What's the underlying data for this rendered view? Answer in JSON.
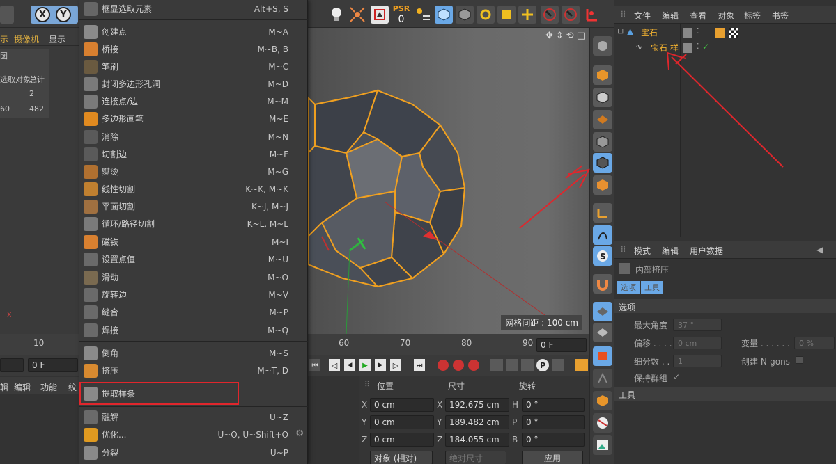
{
  "toolbar": {
    "axis_x": "X",
    "axis_y": "Y",
    "psr_label": "PSR",
    "psr_value": "0"
  },
  "left_panel": {
    "tabs": [
      "示",
      "摄像机",
      "显示"
    ],
    "tab3_label": "图",
    "stats_header": [
      "选取对象",
      "总计"
    ],
    "stats_row1": [
      "",
      "2"
    ],
    "stats_row2": [
      "60",
      "482"
    ]
  },
  "menu": {
    "items": [
      {
        "label": "框显选取元素",
        "shortcut": "Alt+S, S",
        "icon": "frame-select-icon"
      },
      {
        "label": "创建点",
        "shortcut": "M~A",
        "icon": "create-point-icon"
      },
      {
        "label": "桥接",
        "shortcut": "M~B, B",
        "icon": "bridge-icon"
      },
      {
        "label": "笔刷",
        "shortcut": "M~C",
        "icon": "brush-icon"
      },
      {
        "label": "封闭多边形孔洞",
        "shortcut": "M~D",
        "icon": "close-hole-icon"
      },
      {
        "label": "连接点/边",
        "shortcut": "M~M",
        "icon": "connect-icon"
      },
      {
        "label": "多边形画笔",
        "shortcut": "M~E",
        "icon": "polygon-pen-icon"
      },
      {
        "label": "消除",
        "shortcut": "M~N",
        "icon": "dissolve-icon"
      },
      {
        "label": "切割边",
        "shortcut": "M~F",
        "icon": "edge-cut-icon"
      },
      {
        "label": "熨烫",
        "shortcut": "M~G",
        "icon": "iron-icon"
      },
      {
        "label": "线性切割",
        "shortcut": "K~K, M~K",
        "icon": "line-cut-icon"
      },
      {
        "label": "平面切割",
        "shortcut": "K~J, M~J",
        "icon": "plane-cut-icon"
      },
      {
        "label": "循环/路径切割",
        "shortcut": "K~L, M~L",
        "icon": "loop-cut-icon"
      },
      {
        "label": "磁铁",
        "shortcut": "M~I",
        "icon": "magnet-icon"
      },
      {
        "label": "设置点值",
        "shortcut": "M~U",
        "icon": "set-point-icon"
      },
      {
        "label": "滑动",
        "shortcut": "M~O",
        "icon": "slide-icon"
      },
      {
        "label": "旋转边",
        "shortcut": "M~V",
        "icon": "spin-edge-icon"
      },
      {
        "label": "缝合",
        "shortcut": "M~P",
        "icon": "stitch-icon"
      },
      {
        "label": "焊接",
        "shortcut": "M~Q",
        "icon": "weld-icon"
      },
      {
        "label": "倒角",
        "shortcut": "M~S",
        "icon": "bevel-icon"
      },
      {
        "label": "挤压",
        "shortcut": "M~T, D",
        "icon": "extrude-icon"
      },
      {
        "label": "提取样条",
        "shortcut": "",
        "icon": "extract-spline-icon"
      },
      {
        "label": "融解",
        "shortcut": "U~Z",
        "icon": "melt-icon"
      },
      {
        "label": "优化...",
        "shortcut": "U~O, U~Shift+O",
        "icon": "optimize-icon"
      },
      {
        "label": "分裂",
        "shortcut": "U~P",
        "icon": "split-icon"
      }
    ]
  },
  "viewport": {
    "grid_spacing": "网格间距 : 100 cm"
  },
  "object_manager": {
    "menu": [
      "文件",
      "编辑",
      "查看",
      "对象",
      "标签",
      "书签"
    ],
    "objects": [
      {
        "name": "宝石"
      },
      {
        "name": "宝石 样"
      }
    ]
  },
  "attributes": {
    "menu": [
      "模式",
      "编辑",
      "用户数据"
    ],
    "tool_name": "内部挤压",
    "tabs": [
      "选项",
      "工具"
    ],
    "section_options": "选项",
    "section_tool": "工具",
    "fields": {
      "max_angle_label": "最大角度",
      "max_angle_value": "37 °",
      "offset_label": "偏移 . . . .",
      "offset_value": "0 cm",
      "variance_label": "变量 . . . . . .",
      "variance_value": "0 %",
      "subdivision_label": "细分数 . .",
      "subdivision_value": "1",
      "create_ngons_label": "创建 N-gons",
      "preserve_groups_label": "保持群组",
      "preserve_groups_check": "✓"
    }
  },
  "timeline": {
    "ticks": [
      "10",
      "60",
      "70",
      "80",
      "90"
    ],
    "end_frame": "0 F",
    "start_frame": "0 F"
  },
  "bottom_left": {
    "menu": [
      "辑",
      "编辑",
      "功能",
      "纹"
    ]
  },
  "coordinates": {
    "headers": [
      "位置",
      "尺寸",
      "旋转"
    ],
    "rows": [
      {
        "axis_p": "X",
        "pos": "0 cm",
        "axis_s": "X",
        "size": "192.675 cm",
        "axis_r": "H",
        "rot": "0 °"
      },
      {
        "axis_p": "Y",
        "pos": "0 cm",
        "axis_s": "Y",
        "size": "189.482 cm",
        "axis_r": "P",
        "rot": "0 °"
      },
      {
        "axis_p": "Z",
        "pos": "0 cm",
        "axis_s": "Z",
        "size": "184.055 cm",
        "axis_r": "B",
        "rot": "0 °"
      }
    ],
    "mode_select": "对象 (相对)",
    "size_select": "绝对尺寸",
    "apply_button": "应用"
  },
  "colors": {
    "accent_orange": "#e8a030",
    "highlight_red": "#e0262c",
    "selection_blue": "#6aa8e6"
  }
}
